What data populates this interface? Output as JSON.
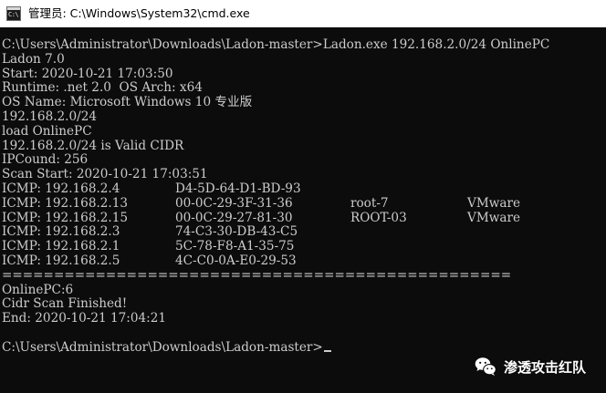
{
  "window": {
    "icon_glyph": "C:\\",
    "title": "管理员: C:\\Windows\\System32\\cmd.exe"
  },
  "console": {
    "header_lines": [
      "C:\\Users\\Administrator\\Downloads\\Ladon-master>Ladon.exe 192.168.2.0/24 OnlinePC",
      "Ladon 7.0",
      "Start: 2020-10-21 17:03:50",
      "Runtime: .net 2.0  OS Arch: x64",
      "OS Name: Microsoft Windows 10 专业版",
      "192.168.2.0/24",
      "load OnlinePC",
      "192.168.2.0/24 is Valid CIDR",
      "IPCound: 256",
      "Scan Start: 2020-10-21 17:03:51"
    ],
    "icmp_rows": [
      {
        "ip": "ICMP: 192.168.2.4",
        "mac": "D4-5D-64-D1-BD-93",
        "host": "",
        "vendor": ""
      },
      {
        "ip": "ICMP: 192.168.2.13",
        "mac": "00-0C-29-3F-31-36",
        "host": "root-7",
        "vendor": "VMware"
      },
      {
        "ip": "ICMP: 192.168.2.15",
        "mac": "00-0C-29-27-81-30",
        "host": "ROOT-03",
        "vendor": "VMware"
      },
      {
        "ip": "ICMP: 192.168.2.3",
        "mac": "74-C3-30-DB-43-C5",
        "host": "",
        "vendor": ""
      },
      {
        "ip": "ICMP: 192.168.2.1",
        "mac": "5C-78-F8-A1-35-75",
        "host": "",
        "vendor": ""
      },
      {
        "ip": "ICMP: 192.168.2.5",
        "mac": "4C-C0-0A-E0-29-53",
        "host": "",
        "vendor": ""
      }
    ],
    "separator": "=================================================",
    "footer_lines": [
      "OnlinePC:6",
      "Cidr Scan Finished!",
      "End: 2020-10-21 17:04:21"
    ],
    "prompt": "C:\\Users\\Administrator\\Downloads\\Ladon-master>"
  },
  "watermark": {
    "icon": "wechat-icon",
    "text": "渗透攻击红队"
  }
}
